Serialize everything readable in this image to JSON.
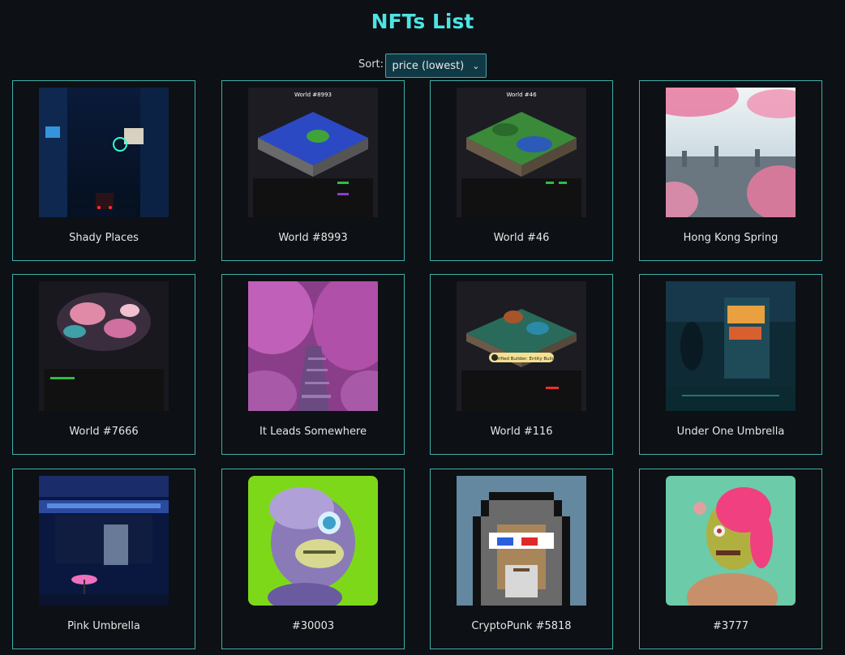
{
  "header": {
    "title": "NFTs List"
  },
  "sort": {
    "label": "Sort:",
    "selected": "price (lowest)"
  },
  "nfts": [
    {
      "name": "Shady Places"
    },
    {
      "name": "World #8993",
      "image_text": "World #8993"
    },
    {
      "name": "World #46",
      "image_text": "World #46"
    },
    {
      "name": "Hong Kong Spring"
    },
    {
      "name": "World #7666"
    },
    {
      "name": "It Leads Somewhere"
    },
    {
      "name": "World #116",
      "badge": "Verified Builder: Entity Builds"
    },
    {
      "name": "Under One Umbrella"
    },
    {
      "name": "Pink Umbrella"
    },
    {
      "name": "#30003"
    },
    {
      "name": "CryptoPunk #5818"
    },
    {
      "name": "#3777"
    }
  ]
}
